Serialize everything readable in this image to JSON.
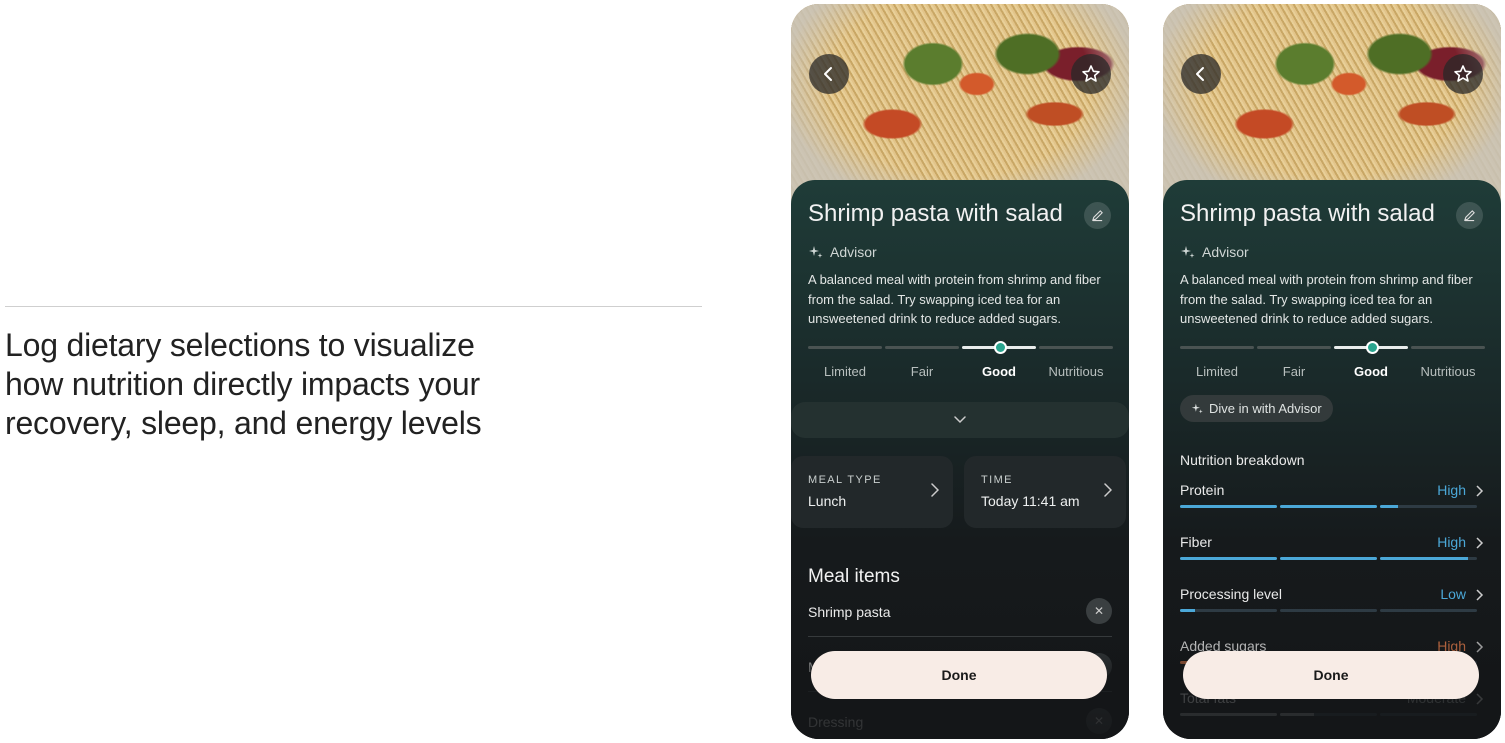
{
  "caption": {
    "line1": "Log dietary selections to visualize",
    "line2": "how nutrition directly impacts your",
    "line3": "recovery, sleep, and energy levels"
  },
  "meal": {
    "title": "Shrimp pasta with salad",
    "advisor_label": "Advisor",
    "advisor_text": "A balanced meal with protein from shrimp and fiber from the salad. Try swapping iced tea for an unsweetened drink to reduce added sugars.",
    "scale": {
      "labels": [
        "Limited",
        "Fair",
        "Good",
        "Nutritious"
      ],
      "selected": "Good"
    }
  },
  "left_screen": {
    "meal_type_label": "MEAL TYPE",
    "meal_type_value": "Lunch",
    "time_label": "TIME",
    "time_value": "Today 11:41 am",
    "meal_items_heading": "Meal items",
    "meal_items": [
      "Shrimp pasta",
      "M",
      "Dressing"
    ],
    "done_label": "Done"
  },
  "right_screen": {
    "dive_label": "Dive in with Advisor",
    "breakdown_heading": "Nutrition breakdown",
    "nutrients": [
      {
        "name": "Protein",
        "level": "High",
        "fill": 0.73,
        "color": "#4ba8d8"
      },
      {
        "name": "Fiber",
        "level": "High",
        "fill": 0.97,
        "color": "#4ba8d8"
      },
      {
        "name": "Processing level",
        "level": "Low",
        "fill": 0.05,
        "color": "#4ba8d8"
      },
      {
        "name": "Added sugars",
        "level": "High",
        "fill": 0.9,
        "color": "#e07a4a"
      },
      {
        "name": "Total fats",
        "level": "Moderate",
        "fill": 0.45,
        "color": "#9aa0a0"
      }
    ],
    "done_label": "Done"
  },
  "colors": {
    "accent_teal": "#2aa58f",
    "level_blue": "#4ba8d8",
    "level_orange": "#e07a4a",
    "done_button_bg": "#f8ece6"
  },
  "icons": [
    "chevron-left-icon",
    "star-icon",
    "pencil-icon",
    "sparkle-icon",
    "chevron-down-icon",
    "chevron-right-icon",
    "close-icon"
  ]
}
